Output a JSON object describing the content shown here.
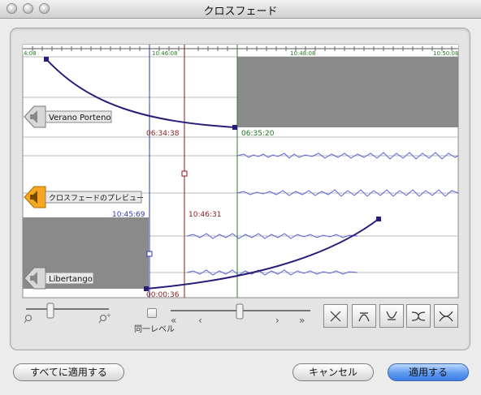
{
  "window": {
    "title": "クロスフェード"
  },
  "timeline": {
    "ruler_labels": [
      "4:08",
      "10:46:08",
      "10:48:08",
      "10:50:08"
    ],
    "track_a": {
      "name": "Verano Porteno",
      "start_time": "06:34:38",
      "end_time": "06:35:20"
    },
    "track_b": {
      "name": "Libertango",
      "start_time": "10:45:69",
      "end_time": "00:00:36"
    },
    "preview_label": "クロスフェードのプレビュー",
    "playhead_time": "10:46:31"
  },
  "controls": {
    "same_level_label": "同一レベル",
    "same_level_checked": false
  },
  "buttons": {
    "apply_all": "すべてに適用する",
    "cancel": "キャンセル",
    "apply": "適用する"
  },
  "colors": {
    "curve": "#2a1a7a",
    "marker_blue": "#2a3ab0",
    "marker_red": "#8b1a1a",
    "marker_green": "#1f8a1f",
    "waveform": "#5b63d6",
    "accent_button": "#3d7ee6"
  }
}
